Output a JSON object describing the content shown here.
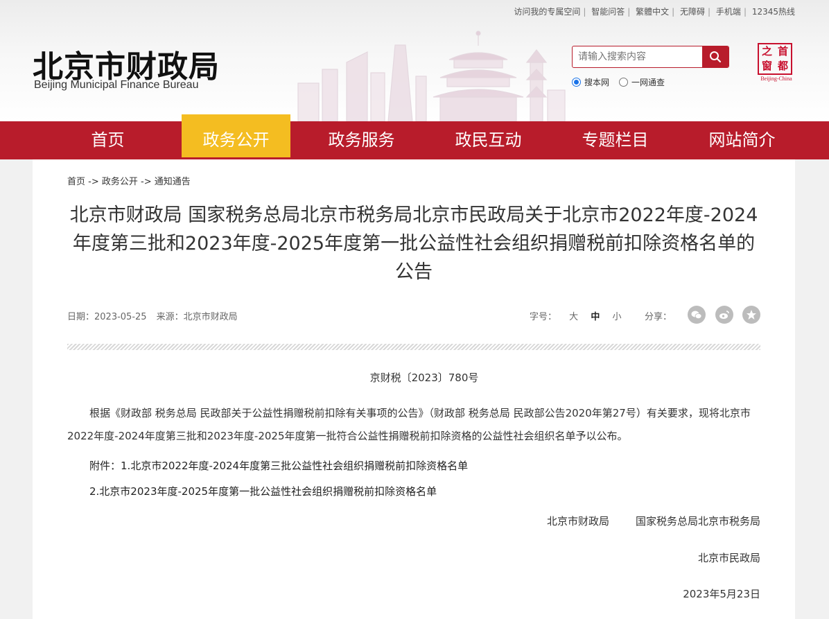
{
  "top_links": [
    "访问我的专属空间",
    "智能问答",
    "繁體中文",
    "无障碍",
    "手机端",
    "12345热线"
  ],
  "logo": {
    "cn": "北京市财政局",
    "en": "Beijing Municipal Finance Bureau"
  },
  "search": {
    "placeholder": "请输入搜索内容",
    "options": [
      "搜本网",
      "一网通查"
    ],
    "selected": "搜本网"
  },
  "seal": {
    "chars": [
      "之",
      "首",
      "窗",
      "都"
    ],
    "en": "Beijing-China"
  },
  "nav": {
    "items": [
      "首页",
      "政务公开",
      "政务服务",
      "政民互动",
      "专题栏目",
      "网站简介"
    ],
    "active": "政务公开"
  },
  "breadcrumb": [
    "首页",
    "政务公开",
    "通知通告"
  ],
  "article": {
    "title": "北京市财政局 国家税务总局北京市税务局北京市民政局关于北京市2022年度-2024年度第三批和2023年度-2025年度第一批公益性社会组织捐赠税前扣除资格名单的公告",
    "date_label": "日期：",
    "date": "2023-05-25",
    "source_label": "来源：",
    "source": "北京市财政局",
    "font_label": "字号：",
    "font_options": [
      "大",
      "中",
      "小"
    ],
    "font_current": "中",
    "share_label": "分享：",
    "share_icons": [
      "wechat-icon",
      "weibo-icon",
      "favorite-icon"
    ],
    "doc_number": "京财税〔2023〕780号",
    "body": "根据《财政部 税务总局 民政部关于公益性捐赠税前扣除有关事项的公告》（财政部 税务总局 民政部公告2020年第27号）有关要求，现将北京市2022年度-2024年度第三批和2023年度-2025年度第一批符合公益性捐赠税前扣除资格的公益性社会组织名单予以公布。",
    "attachment_label": "附件：",
    "attachments": [
      "1.北京市2022年度-2024年度第三批公益性社会组织捐赠税前扣除资格名单",
      "2.北京市2023年度-2025年度第一批公益性社会组织捐赠税前扣除资格名单"
    ],
    "signers": {
      "line1_a": "北京市财政局",
      "line1_b": "国家税务总局北京市税务局",
      "line2": "北京市民政局"
    },
    "sign_date": "2023年5月23日"
  },
  "colors": {
    "brand_red": "#b81c2b",
    "nav_active": "#f4bd21"
  }
}
